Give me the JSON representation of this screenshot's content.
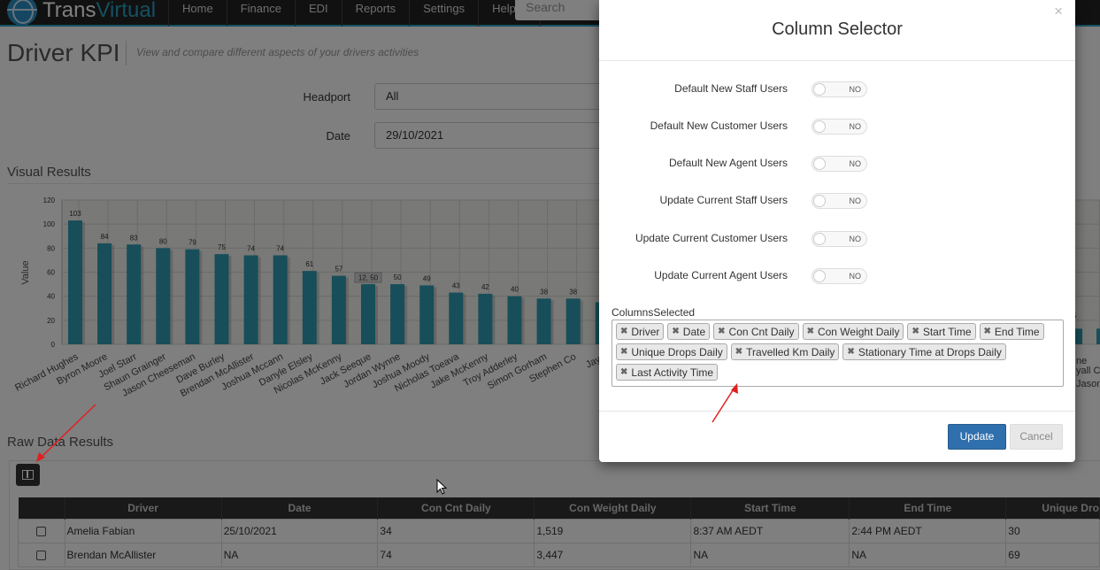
{
  "brand": {
    "part1": "Trans",
    "part2": "Virtual"
  },
  "nav": {
    "items": [
      "Home",
      "Finance",
      "EDI",
      "Reports",
      "Settings"
    ],
    "help": "Help"
  },
  "search": {
    "placeholder": "Search"
  },
  "page": {
    "title": "Driver KPI",
    "subtitle": "View and compare different aspects of your drivers activities",
    "headport_label": "Headport",
    "headport_value": "All",
    "date_label": "Date",
    "date_value": "29/10/2021",
    "visual_results": "Visual Results",
    "raw_results": "Raw Data Results"
  },
  "chart_data": {
    "type": "bar",
    "ylabel": "Value",
    "ylim": [
      0,
      120
    ],
    "yticks": [
      0,
      20,
      40,
      60,
      80,
      100,
      120
    ],
    "categories": [
      "Richard Hughes",
      "Byron Moore",
      "Joel Starr",
      "Shaun Grainger",
      "Jason Cheeseman",
      "Dave Burley",
      "Brendan McAllister",
      "Joshua Mccann",
      "Danyle Elsley",
      "Nicolas McKenny",
      "Jack Seeque",
      "Jordan Wynne",
      "Joshua Moody",
      "Nicholas Toeava",
      "Jake McKenny",
      "Troy Adderley",
      "Simon Gorham",
      "Stephen Co",
      "Jayd"
    ],
    "values": [
      103,
      84,
      83,
      80,
      79,
      75,
      74,
      74,
      61,
      57,
      50,
      50,
      49,
      43,
      42,
      40,
      38,
      38,
      35
    ],
    "data_labels": [
      "103",
      "84",
      "83",
      "80",
      "79",
      "75",
      "74",
      "74",
      "61",
      "57",
      "50",
      "50",
      "49",
      "43",
      "42",
      "40",
      "38",
      "38",
      ""
    ],
    "annotation": "12, 50",
    "right_fragments": [
      "ne",
      "yall C",
      "Jason"
    ],
    "right_label": "5",
    "grid": true
  },
  "table": {
    "headers": [
      "Driver",
      "Date",
      "Con Cnt Daily",
      "Con Weight Daily",
      "Start Time",
      "End Time",
      "Unique Dro"
    ],
    "rows": [
      [
        "Amelia Fabian",
        "25/10/2021",
        "34",
        "1,519",
        "8:37 AM AEDT",
        "2:44 PM AEDT",
        "30"
      ],
      [
        "Brendan McAllister",
        "NA",
        "74",
        "3,447",
        "NA",
        "NA",
        "69"
      ]
    ]
  },
  "modal": {
    "title": "Column Selector",
    "close": "×",
    "options": [
      {
        "label": "Default New Staff Users",
        "state": "NO"
      },
      {
        "label": "Default New Customer Users",
        "state": "NO"
      },
      {
        "label": "Default New Agent Users",
        "state": "NO"
      },
      {
        "label": "Update Current Staff Users",
        "state": "NO"
      },
      {
        "label": "Update Current Customer Users",
        "state": "NO"
      },
      {
        "label": "Update Current Agent Users",
        "state": "NO"
      }
    ],
    "columns_label": "ColumnsSelected",
    "columns": [
      "Driver",
      "Date",
      "Con Cnt Daily",
      "Con Weight Daily",
      "Start Time",
      "End Time",
      "Unique Drops Daily",
      "Travelled Km Daily",
      "Stationary Time at Drops Daily",
      "Last Activity Time"
    ],
    "update": "Update",
    "cancel": "Cancel"
  },
  "colors": {
    "bar": "#2e9db3",
    "primary": "#2f6fad",
    "arrow": "#e02020"
  }
}
